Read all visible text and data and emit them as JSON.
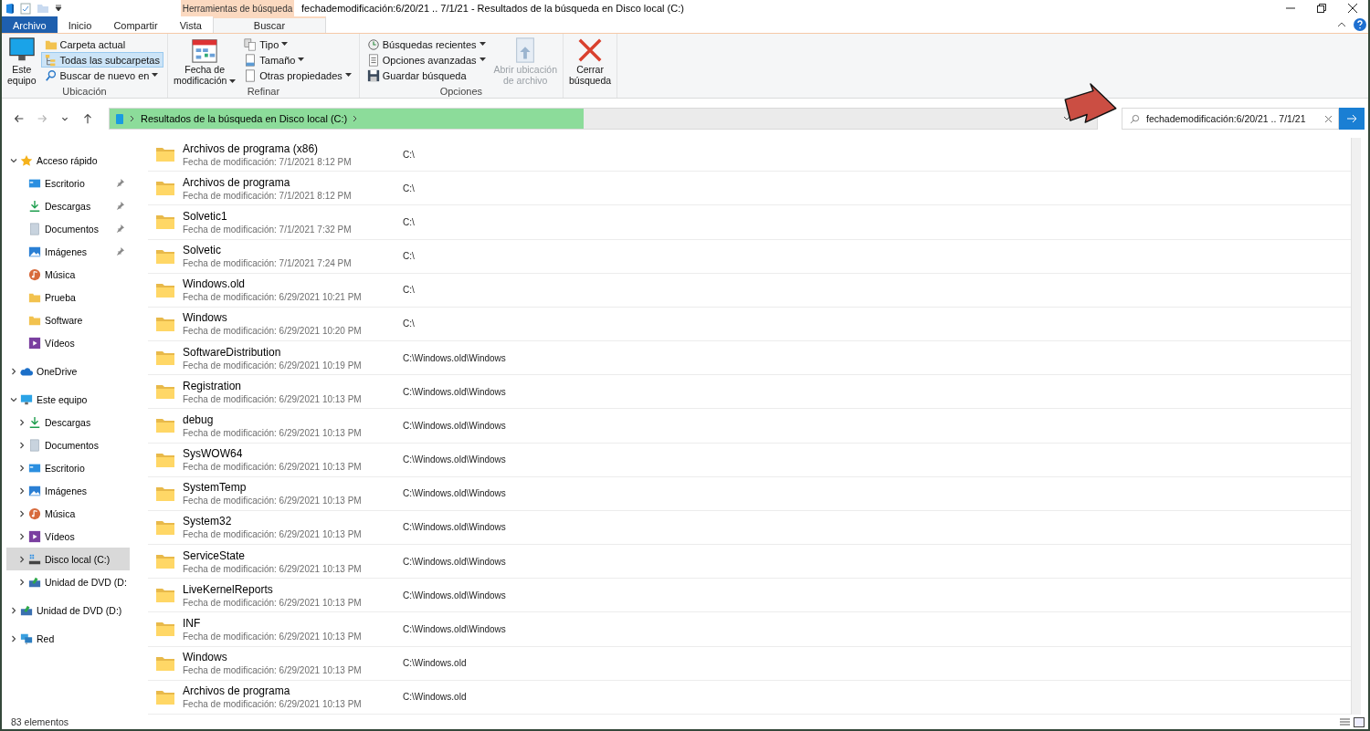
{
  "window": {
    "title": "fechademodificación:6/20/21 .. 7/1/21 - Resultados de la búsqueda en Disco local (C:)"
  },
  "ribbon": {
    "context_label": "Herramientas de búsqueda",
    "tabs": [
      {
        "label": "Archivo",
        "kind": "file",
        "selected": false
      },
      {
        "label": "Inicio",
        "kind": "plain",
        "selected": false
      },
      {
        "label": "Compartir",
        "kind": "plain",
        "selected": false
      },
      {
        "label": "Vista",
        "kind": "plain",
        "selected": false
      },
      {
        "label": "Buscar",
        "kind": "context",
        "selected": true
      }
    ],
    "groups": [
      {
        "label": "Ubicación",
        "buttons": [
          {
            "kind": "computer",
            "label": "Este\nequipo",
            "selected": false,
            "dropdown": false,
            "disabled": false
          },
          {
            "kind": "folder",
            "label": "Carpeta actual",
            "selected": false,
            "dropdown": false,
            "disabled": false
          },
          {
            "kind": "subfolders",
            "label": "Todas las subcarpetas",
            "selected": true,
            "dropdown": false,
            "disabled": false
          },
          {
            "kind": "search-again",
            "label": "Buscar de nuevo en",
            "selected": false,
            "dropdown": true,
            "disabled": false
          }
        ]
      },
      {
        "label": "Refinar",
        "buttons": [
          {
            "kind": "calendar",
            "label": "Fecha de\nmodificación",
            "dropdown": true,
            "disabled": false
          },
          {
            "kind": "type",
            "label": "Tipo",
            "dropdown": true,
            "disabled": false
          },
          {
            "kind": "size",
            "label": "Tamaño",
            "dropdown": true,
            "disabled": false
          },
          {
            "kind": "properties",
            "label": "Otras propiedades",
            "dropdown": true,
            "disabled": false
          }
        ]
      },
      {
        "label": "Opciones",
        "buttons": [
          {
            "kind": "recent",
            "label": "Búsquedas recientes",
            "dropdown": true,
            "disabled": false
          },
          {
            "kind": "advanced",
            "label": "Opciones avanzadas",
            "dropdown": true,
            "disabled": false
          },
          {
            "kind": "save",
            "label": "Guardar búsqueda",
            "dropdown": false,
            "disabled": false
          },
          {
            "kind": "open-location",
            "label": "Abrir ubicación\nde archivo",
            "dropdown": false,
            "disabled": true
          }
        ]
      },
      {
        "buttons": [
          {
            "kind": "close",
            "label": "Cerrar\nbúsqueda",
            "dropdown": false,
            "disabled": false
          }
        ]
      }
    ]
  },
  "nav": [
    {
      "kind": "back",
      "disabled": false
    },
    {
      "kind": "forward",
      "disabled": true
    },
    {
      "kind": "recent",
      "disabled": false
    },
    {
      "kind": "up",
      "disabled": false
    }
  ],
  "address": {
    "location": "Resultados de la búsqueda en Disco local (C:)",
    "progress": {
      "level": 0.48
    }
  },
  "search": {
    "value": "fechademodificación:6/20/21 .. 7/1/21"
  },
  "sidebar": {
    "items": [
      {
        "label": "Acceso rápido",
        "kind": "star",
        "expanded": true,
        "selected": false,
        "children": [
          {
            "label": "Escritorio",
            "kind": "desktop",
            "pinned": true,
            "selected": false
          },
          {
            "label": "Descargas",
            "kind": "download",
            "pinned": true,
            "selected": false
          },
          {
            "label": "Documentos",
            "kind": "documents",
            "pinned": true,
            "selected": false
          },
          {
            "label": "Imágenes",
            "kind": "pictures",
            "pinned": true,
            "selected": false
          },
          {
            "label": "Música",
            "kind": "music",
            "pinned": false,
            "selected": false
          },
          {
            "label": "Prueba",
            "kind": "folder",
            "pinned": false,
            "selected": false
          },
          {
            "label": "Software",
            "kind": "folder",
            "pinned": false,
            "selected": false
          },
          {
            "label": "Vídeos",
            "kind": "videos",
            "pinned": false,
            "selected": false
          }
        ]
      },
      {
        "label": "OneDrive",
        "kind": "cloud",
        "expanded": false,
        "selected": false
      },
      {
        "label": "Este equipo",
        "kind": "computer",
        "expanded": true,
        "selected": false,
        "children": [
          {
            "label": "Descargas",
            "kind": "download",
            "expanded": false,
            "selected": false
          },
          {
            "label": "Documentos",
            "kind": "documents",
            "expanded": false,
            "selected": false
          },
          {
            "label": "Escritorio",
            "kind": "desktop",
            "expanded": false,
            "selected": false
          },
          {
            "label": "Imágenes",
            "kind": "pictures",
            "expanded": false,
            "selected": false
          },
          {
            "label": "Música",
            "kind": "music",
            "expanded": false,
            "selected": false
          },
          {
            "label": "Vídeos",
            "kind": "videos",
            "expanded": false,
            "selected": false
          },
          {
            "label": "Disco local (C:)",
            "kind": "drive",
            "expanded": false,
            "selected": true
          },
          {
            "label": "Unidad de DVD (D:",
            "kind": "dvd",
            "expanded": false,
            "selected": false
          }
        ]
      },
      {
        "label": "Unidad de DVD (D:)",
        "kind": "dvd",
        "expanded": false,
        "selected": false
      },
      {
        "label": "Red",
        "kind": "network",
        "expanded": false,
        "selected": false
      }
    ]
  },
  "results": [
    {
      "name": "Archivos de programa (x86)",
      "details": "Fecha de modificación: 7/1/2021 8:12 PM",
      "path": "C:\\"
    },
    {
      "name": "Archivos de programa",
      "details": "Fecha de modificación: 7/1/2021 8:12 PM",
      "path": "C:\\"
    },
    {
      "name": "Solvetic1",
      "details": "Fecha de modificación: 7/1/2021 7:32 PM",
      "path": "C:\\"
    },
    {
      "name": "Solvetic",
      "details": "Fecha de modificación: 7/1/2021 7:24 PM",
      "path": "C:\\"
    },
    {
      "name": "Windows.old",
      "details": "Fecha de modificación: 6/29/2021 10:21 PM",
      "path": "C:\\"
    },
    {
      "name": "Windows",
      "details": "Fecha de modificación: 6/29/2021 10:20 PM",
      "path": "C:\\"
    },
    {
      "name": "SoftwareDistribution",
      "details": "Fecha de modificación: 6/29/2021 10:19 PM",
      "path": "C:\\Windows.old\\Windows"
    },
    {
      "name": "Registration",
      "details": "Fecha de modificación: 6/29/2021 10:13 PM",
      "path": "C:\\Windows.old\\Windows"
    },
    {
      "name": "debug",
      "details": "Fecha de modificación: 6/29/2021 10:13 PM",
      "path": "C:\\Windows.old\\Windows"
    },
    {
      "name": "SysWOW64",
      "details": "Fecha de modificación: 6/29/2021 10:13 PM",
      "path": "C:\\Windows.old\\Windows"
    },
    {
      "name": "SystemTemp",
      "details": "Fecha de modificación: 6/29/2021 10:13 PM",
      "path": "C:\\Windows.old\\Windows"
    },
    {
      "name": "System32",
      "details": "Fecha de modificación: 6/29/2021 10:13 PM",
      "path": "C:\\Windows.old\\Windows"
    },
    {
      "name": "ServiceState",
      "details": "Fecha de modificación: 6/29/2021 10:13 PM",
      "path": "C:\\Windows.old\\Windows"
    },
    {
      "name": "LiveKernelReports",
      "details": "Fecha de modificación: 6/29/2021 10:13 PM",
      "path": "C:\\Windows.old\\Windows"
    },
    {
      "name": "INF",
      "details": "Fecha de modificación: 6/29/2021 10:13 PM",
      "path": "C:\\Windows.old\\Windows"
    },
    {
      "name": "Windows",
      "details": "Fecha de modificación: 6/29/2021 10:13 PM",
      "path": "C:\\Windows.old"
    },
    {
      "name": "Archivos de programa",
      "details": "Fecha de modificación: 6/29/2021 10:13 PM",
      "path": "C:\\Windows.old"
    }
  ],
  "status_bar": {
    "count": "83 elementos"
  }
}
